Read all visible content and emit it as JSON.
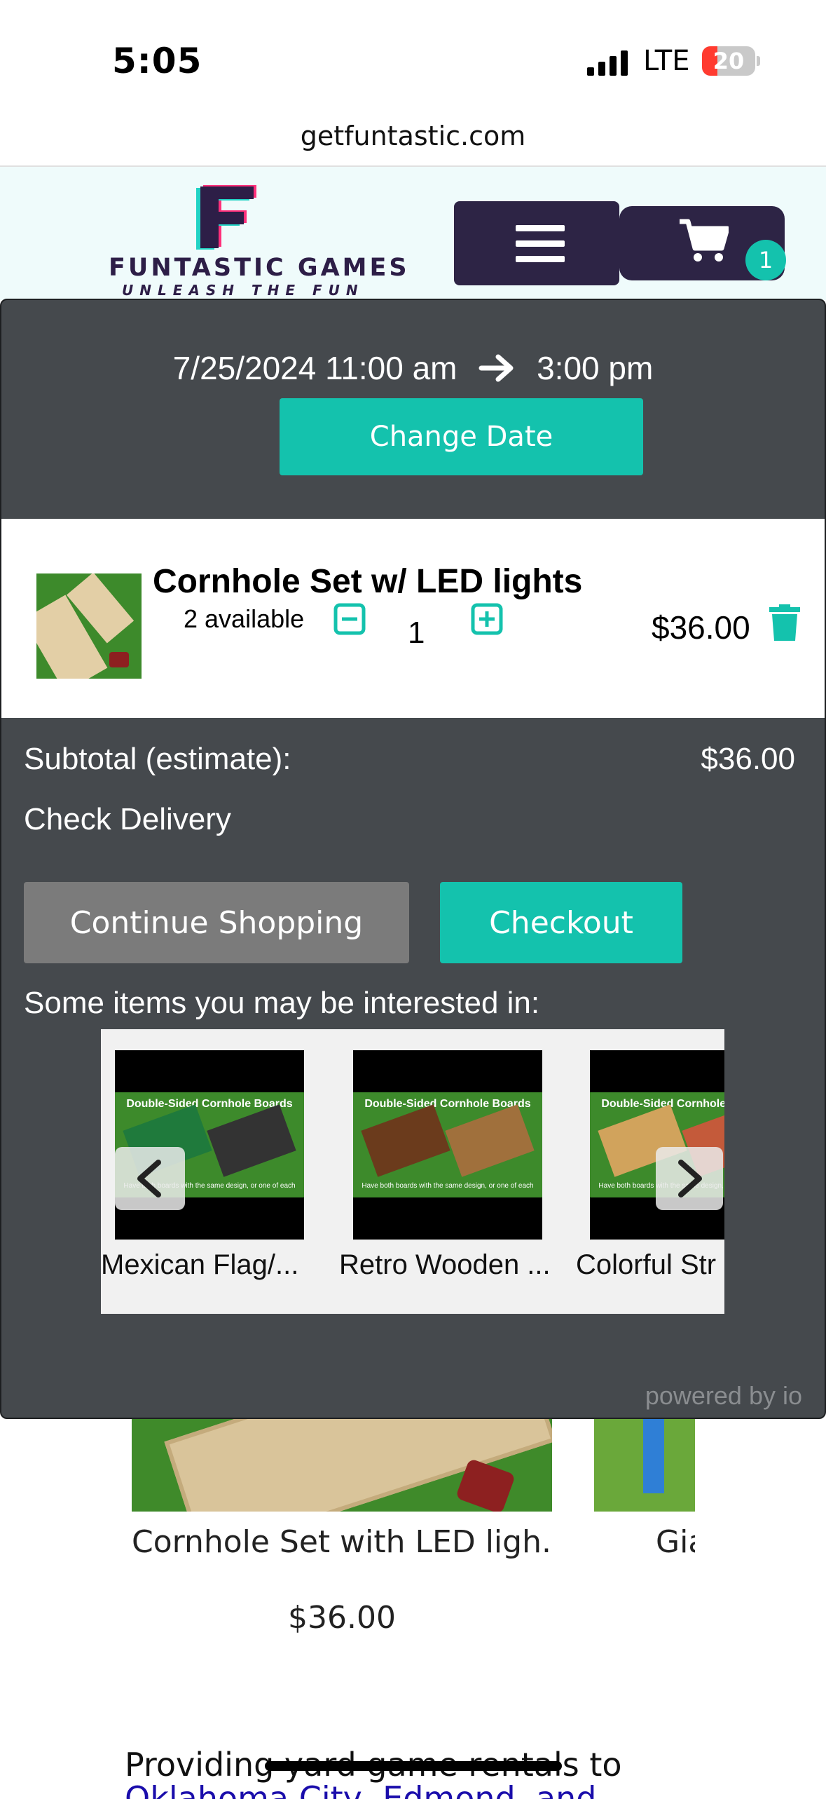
{
  "status_bar": {
    "time": "5:05",
    "network": "LTE",
    "battery": "20"
  },
  "browser": {
    "url": "getfuntastic.com"
  },
  "header": {
    "logo_name": "FUNTASTIC GAMES",
    "logo_tagline": "UNLEASH THE FUN",
    "cart_count": "1"
  },
  "cart": {
    "date_start": "7/25/2024 11:00 am",
    "date_end": "3:00 pm",
    "change_date_label": "Change Date",
    "item": {
      "name": "Cornhole Set w/ LED lights",
      "available": "2 available",
      "quantity": "1",
      "price": "$36.00"
    },
    "subtotal_label": "Subtotal (estimate):",
    "subtotal_value": "$36.00",
    "check_delivery": "Check Delivery",
    "continue_label": "Continue Shopping",
    "checkout_label": "Checkout",
    "suggest_heading": "Some items you may be interested in:",
    "recommendations": [
      {
        "image_caption": "Double-Sided Cornhole Boards",
        "image_subcaption": "Have both boards with the same design, or one of each",
        "name": "Mexican Flag/...",
        "colors": [
          "#1f7a3c",
          "#333333"
        ]
      },
      {
        "image_caption": "Double-Sided Cornhole Boards",
        "image_subcaption": "Have both boards with the same design, or one of each",
        "name": "Retro Wooden ...",
        "colors": [
          "#6b3b1c",
          "#a0703c"
        ]
      },
      {
        "image_caption": "Double-Sided Cornhole Boards",
        "image_subcaption": "Have both boards with the same design, or one of each",
        "name": "Colorful Str",
        "colors": [
          "#d1a35c",
          "#c45a3a"
        ]
      }
    ],
    "powered_by": "powered by io"
  },
  "page": {
    "product_name": "Cornhole Set with LED ligh...",
    "product2_name": "Gia",
    "product_price": "$36.00",
    "providing_text": "Providing yard game rentals to",
    "link_text": "Oklahoma City, Edmond, and"
  },
  "colors": {
    "accent": "#14c2ad",
    "brand_dark": "#2d2445",
    "modal_bg": "#45494d"
  }
}
